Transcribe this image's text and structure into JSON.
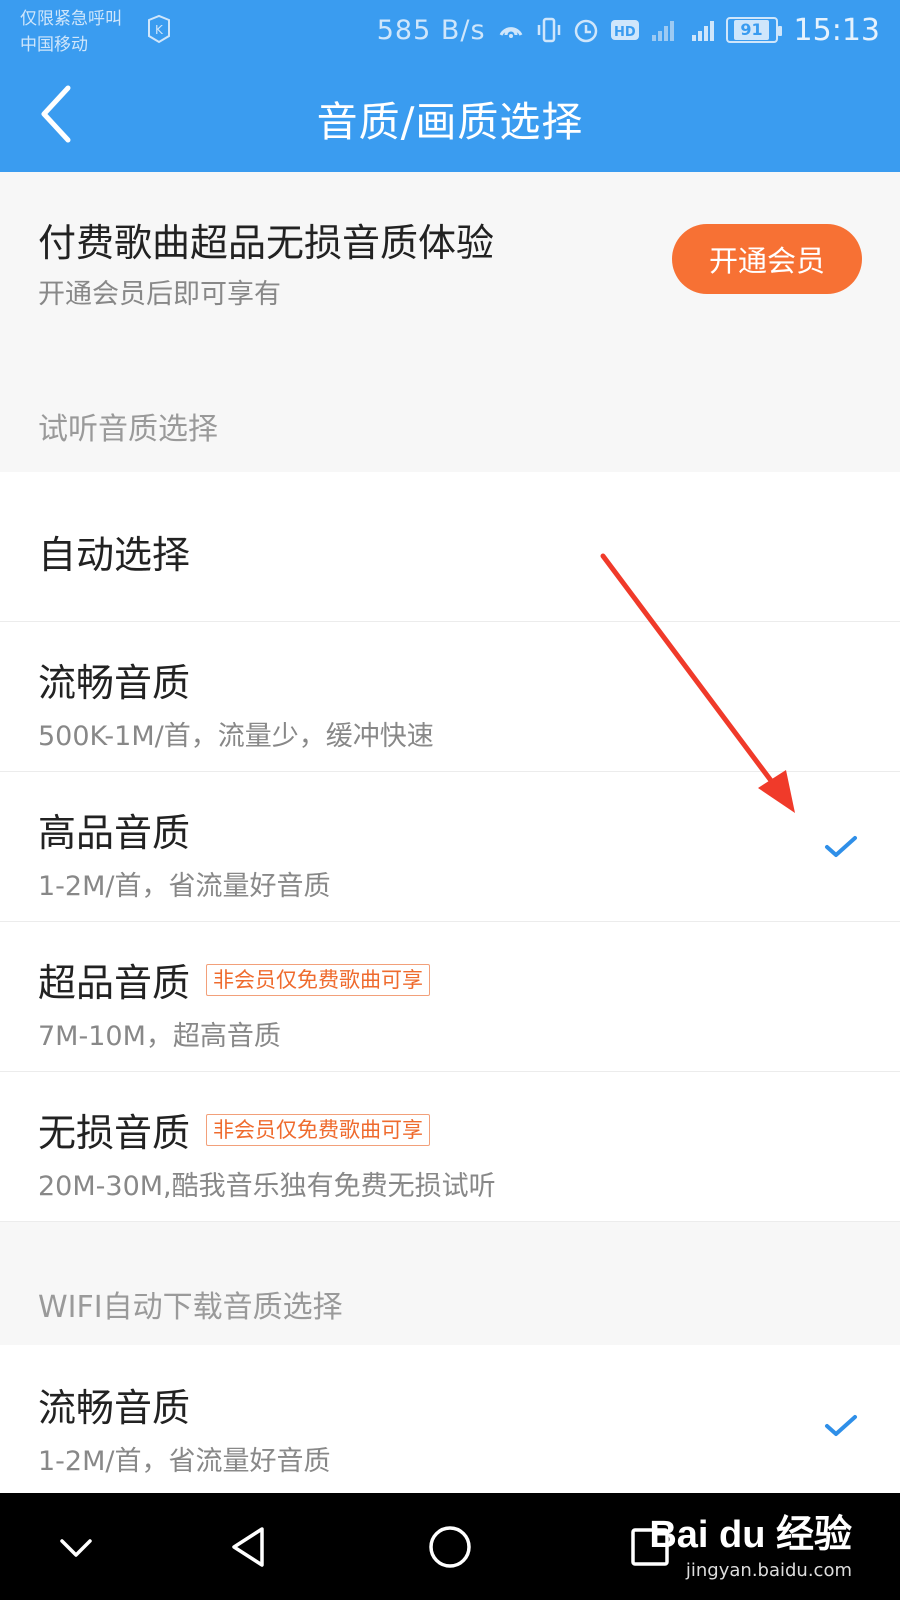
{
  "status": {
    "carrier_line1": "仅限紧急呼叫",
    "carrier_line2": "中国移动",
    "speed": "585 B/s",
    "battery": "91",
    "time": "15:13"
  },
  "header": {
    "title": "音质/画质选择"
  },
  "vip": {
    "title": "付费歌曲超品无损音质体验",
    "subtitle": "开通会员后即可享有",
    "button": "开通会员"
  },
  "listen_section": {
    "label": "试听音质选择",
    "items": [
      {
        "title": "自动选择",
        "subtitle": "",
        "badge": "",
        "checked": false
      },
      {
        "title": "流畅音质",
        "subtitle": "500K-1M/首，流量少，缓冲快速",
        "badge": "",
        "checked": false
      },
      {
        "title": "高品音质",
        "subtitle": "1-2M/首，省流量好音质",
        "badge": "",
        "checked": true
      },
      {
        "title": "超品音质",
        "subtitle": "7M-10M，超高音质",
        "badge": "非会员仅免费歌曲可享",
        "checked": false
      },
      {
        "title": "无损音质",
        "subtitle": "20M-30M,酷我音乐独有免费无损试听",
        "badge": "非会员仅免费歌曲可享",
        "checked": false
      }
    ]
  },
  "wifi_section": {
    "label": "WIFI自动下载音质选择",
    "items": [
      {
        "title": "流畅音质",
        "subtitle": "1-2M/首，省流量好音质",
        "checked": true
      }
    ]
  },
  "watermark": {
    "logo": "Bai du 经验",
    "url": "jingyan.baidu.com"
  },
  "colors": {
    "header": "#3a9cf0",
    "accent_button": "#f77134",
    "check": "#2f8fe8",
    "badge": "#ef6b2e",
    "annotation_arrow": "#f03a2a"
  }
}
